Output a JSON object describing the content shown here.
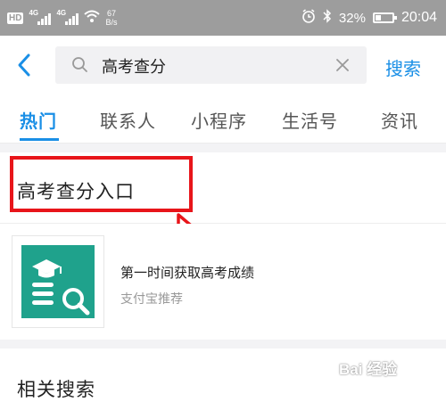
{
  "status_bar": {
    "hd_badge": "HD",
    "network_1": "4G",
    "network_2": "4G",
    "speed_value": "67",
    "speed_unit": "B/s",
    "battery_percent": "32%",
    "battery_level": 0.32,
    "time": "20:04",
    "icons": [
      "wifi-icon",
      "alarm-icon",
      "bluetooth-icon",
      "battery-icon"
    ]
  },
  "search": {
    "query": "高考查分",
    "search_button": "搜索"
  },
  "tabs": [
    {
      "label": "热门"
    },
    {
      "label": "联系人"
    },
    {
      "label": "小程序"
    },
    {
      "label": "生活号"
    },
    {
      "label": "资讯"
    }
  ],
  "result_title": "高考查分入口",
  "card": {
    "title": "第一时间获取高考成绩",
    "subtitle": "支付宝推荐"
  },
  "related_title": "相关搜索",
  "watermark": "Bai 经验",
  "colors": {
    "accent": "#1a8fe6",
    "highlight_box": "#e8151a",
    "icon_tile": "#1fa28c"
  }
}
